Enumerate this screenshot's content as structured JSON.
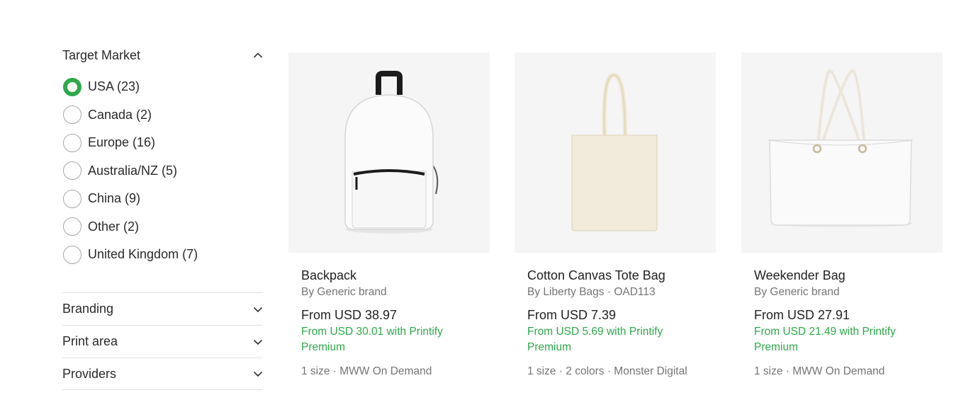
{
  "filters": {
    "target_market": {
      "title": "Target Market",
      "options": [
        {
          "label": "USA (23)",
          "checked": true
        },
        {
          "label": "Canada (2)",
          "checked": false
        },
        {
          "label": "Europe (16)",
          "checked": false
        },
        {
          "label": "Australia/NZ (5)",
          "checked": false
        },
        {
          "label": "China (9)",
          "checked": false
        },
        {
          "label": "Other (2)",
          "checked": false
        },
        {
          "label": "United Kingdom (7)",
          "checked": false
        }
      ]
    },
    "sections": [
      {
        "title": "Branding"
      },
      {
        "title": "Print area"
      },
      {
        "title": "Providers"
      }
    ]
  },
  "products": [
    {
      "name": "Backpack",
      "brand": "By Generic brand",
      "price": "From USD 38.97",
      "premium_price": "From USD 30.01 with Printify Premium",
      "meta": "1 size · MWW On Demand",
      "image_icon": "backpack-image"
    },
    {
      "name": "Cotton Canvas Tote Bag",
      "brand": "By Liberty Bags · OAD113",
      "price": "From USD 7.39",
      "premium_price": "From USD 5.69 with Printify Premium",
      "meta": "1 size · 2 colors · Monster Digital",
      "image_icon": "tote-bag-image"
    },
    {
      "name": "Weekender Bag",
      "brand": "By Generic brand",
      "price": "From USD 27.91",
      "premium_price": "From USD 21.49 with Printify Premium",
      "meta": "1 size · MWW On Demand",
      "image_icon": "weekender-bag-image"
    }
  ],
  "colors": {
    "accent_green": "#2ea84a",
    "muted_text": "#757575",
    "image_background": "#f5f5f5"
  }
}
